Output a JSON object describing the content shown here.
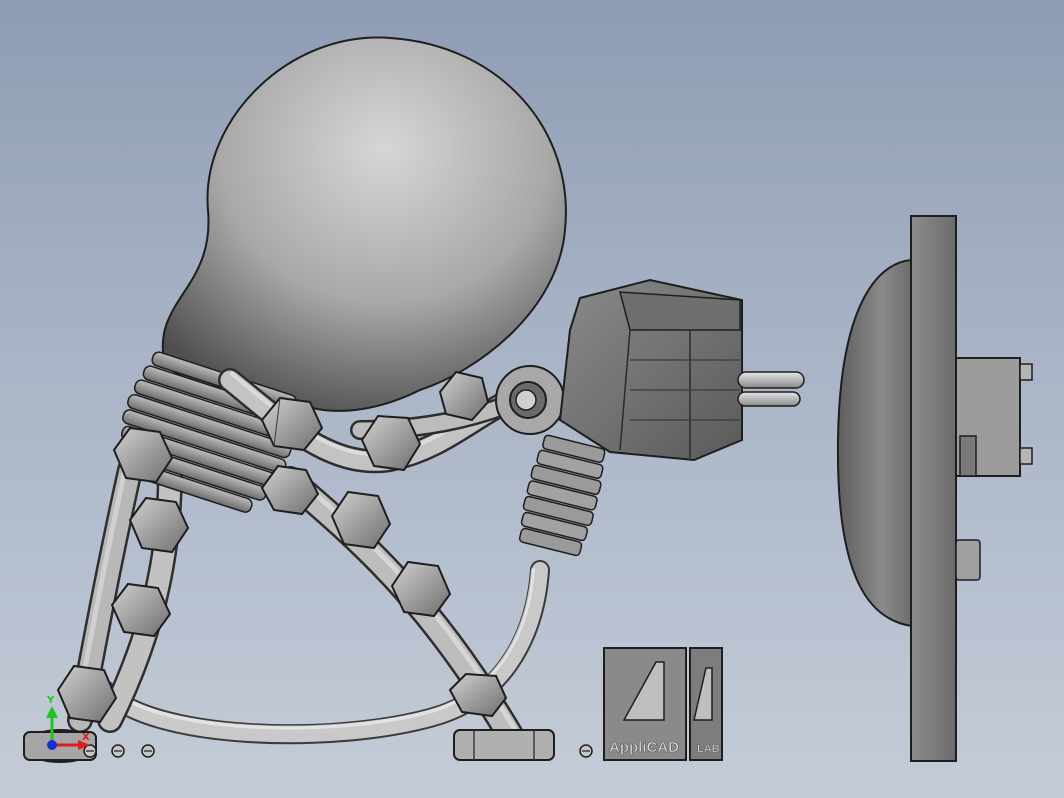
{
  "viewport": {
    "background_top": "#8e9db4",
    "background_bottom": "#c5ccd8",
    "model_description_visible": false
  },
  "triad": {
    "y_label": "Y",
    "x_label": "X",
    "y_color": "#1fc41f",
    "x_color": "#e01d1d",
    "z_color": "#1a2fd0"
  },
  "logo": {
    "text_main": "AppliCAD",
    "text_side": "LAB"
  },
  "colors": {
    "metal_light": "#d4d4d4",
    "metal_mid": "#9a9a9a",
    "metal_dark": "#4a4a4a",
    "outline": "#1e1e1e"
  }
}
